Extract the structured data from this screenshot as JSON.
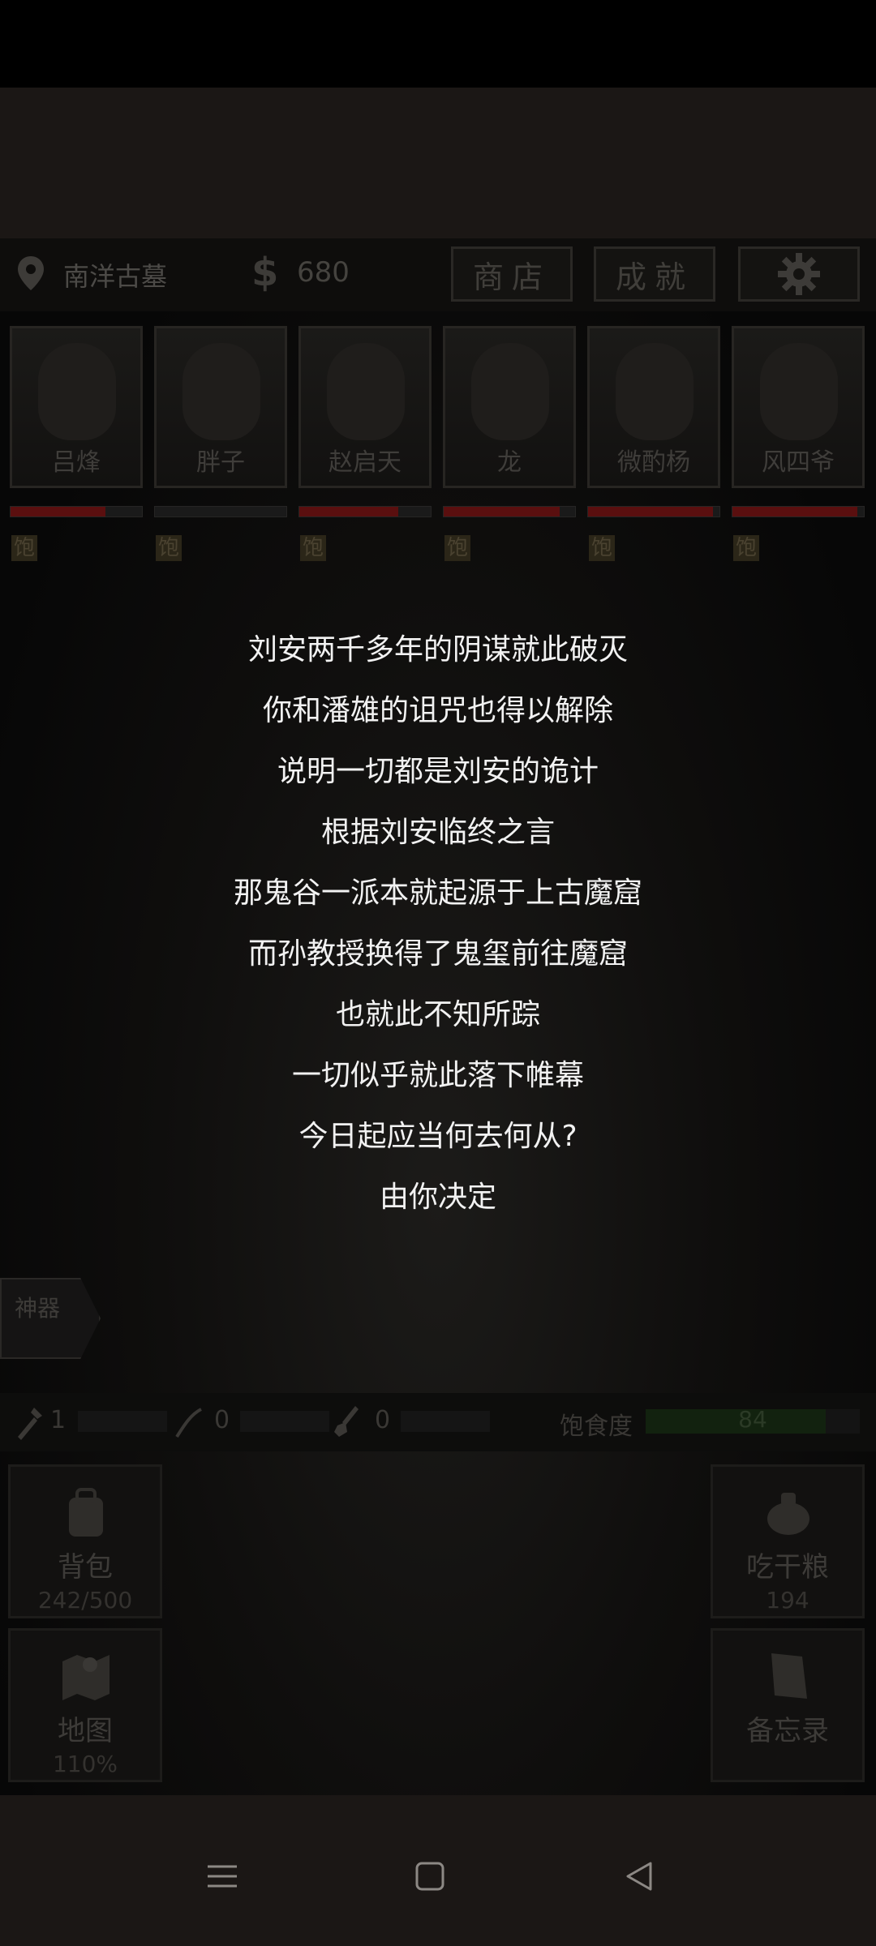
{
  "location": "南洋古墓",
  "money": "680",
  "buttons": {
    "shop": "商店",
    "achievements": "成就"
  },
  "characters": [
    {
      "name": "吕烽",
      "hp": 0.72,
      "status": "饱"
    },
    {
      "name": "胖子",
      "hp": 0.0,
      "status": "饱"
    },
    {
      "name": "赵启天",
      "hp": 0.75,
      "status": "饱"
    },
    {
      "name": "龙",
      "hp": 0.88,
      "status": "饱"
    },
    {
      "name": "微酌杨",
      "hp": 0.95,
      "status": "饱"
    },
    {
      "name": "风四爷",
      "hp": 0.95,
      "status": "饱"
    }
  ],
  "story": [
    "刘安两千多年的阴谋就此破灭",
    "你和潘雄的诅咒也得以解除",
    "说明一切都是刘安的诡计",
    "根据刘安临终之言",
    "那鬼谷一派本就起源于上古魔窟",
    "而孙教授换得了鬼玺前往魔窟",
    "也就此不知所踪",
    "一切似乎就此落下帷幕",
    "今日起应当何去何从?",
    "由你决定"
  ],
  "artifact_label": "神器",
  "tools": [
    {
      "count": "1"
    },
    {
      "count": "0"
    },
    {
      "count": "0"
    }
  ],
  "satiety": {
    "label": "饱食度",
    "value": "84",
    "fraction": 0.84
  },
  "tiles": {
    "backpack": {
      "label": "背包",
      "sub": "242/500"
    },
    "eat": {
      "label": "吃干粮",
      "sub": "194"
    },
    "map": {
      "label": "地图",
      "sub": "110%"
    },
    "memo": {
      "label": "备忘录"
    }
  },
  "colors": {
    "story_text": "#f2f2f2",
    "hp_fill": "#5a0f0f",
    "satiety_fill": "#12220f"
  }
}
